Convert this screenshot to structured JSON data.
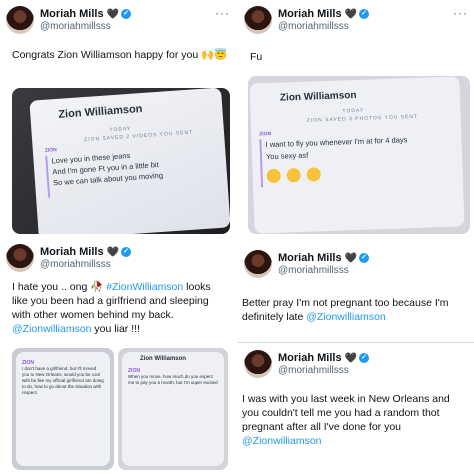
{
  "tweets": [
    {
      "name": "Moriah Mills",
      "handle": "@moriahmillsss",
      "text": "Congrats Zion Williamson happy for you 🙌😇",
      "photo": {
        "title": "Zion Williamson",
        "status": "TODAY",
        "sub": "ZION SAVED 2 VIDEOS YOU SENT",
        "sender": "ZION",
        "message": "Love you in these jeans\nAnd I'm gone Ft you in a little bit\nSo we can talk about you moving"
      }
    },
    {
      "name": "Moriah Mills",
      "handle": "@moriahmillsss",
      "text": "Fu",
      "photo": {
        "title": "Zion Williamson",
        "status": "TODAY",
        "sub": "ZION SAVED 3 PHOTOS YOU SENT",
        "sender": "ZION",
        "message": "I want to fly you whenever I'm at for 4 days\nYou sexy asf"
      }
    },
    {
      "name": "Moriah Mills",
      "handle": "@moriahmillsss",
      "text_a": "I hate you .. ong 🥀 ",
      "hashtag": "#ZionWilliamson",
      "text_b": " looks like you been had a girlfriend and sleeping with other women behind my back. ",
      "mention": "@Zionwilliamson",
      "text_c": " you liar !!!",
      "photo_left": {
        "sender": "ZION",
        "message": "I don't have a girlfriend, but I'll moved you to New Orleans, would you be cool with be like my official girlfriend am doing to do, how to go about the situation with respect"
      },
      "photo_right": {
        "title": "Zion Williamson",
        "sender": "ZION",
        "message": "When you move, how much do you expect me to pay you a month, but I'm super excited"
      }
    },
    {
      "name": "Moriah Mills",
      "handle": "@moriahmillsss",
      "text": "Better pray I'm not pregnant too because I'm definitely late ",
      "mention": "@Zionwilliamson"
    },
    {
      "name": "Moriah Mills",
      "handle": "@moriahmillsss",
      "text": "I was with you last week in New Orleans and you couldn't tell me you had a random thot pregnant after all I've done for you ",
      "mention": "@Zionwilliamson"
    }
  ],
  "icons": {
    "heart": "black-heart",
    "verified": "verified-badge",
    "more": "more-options"
  },
  "colors": {
    "link": "#1d9bf0",
    "verified": "#1d9bf0",
    "handle": "#536471"
  },
  "more_glyph": "···",
  "heart_glyph": "🖤",
  "verified_glyph": "✓"
}
